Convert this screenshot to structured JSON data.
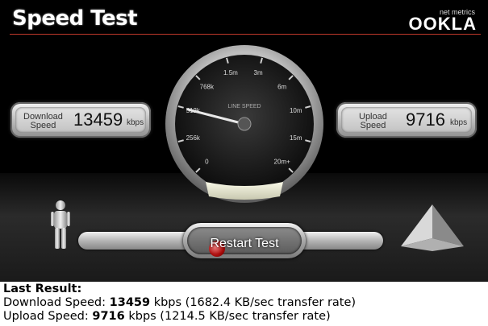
{
  "header": {
    "title": "Speed Test",
    "brand_sub": "net metrics",
    "brand_logo": "OOKLA"
  },
  "gauge": {
    "label": "LINE SPEED",
    "ticks": [
      "0",
      "256k",
      "512k",
      "768k",
      "1.5m",
      "3m",
      "6m",
      "10m",
      "15m",
      "20m+"
    ],
    "needle_fraction": 0.22
  },
  "download": {
    "label_line1": "Download",
    "label_line2": "Speed",
    "value": "13459",
    "unit": "kbps"
  },
  "upload": {
    "label_line1": "Upload",
    "label_line2": "Speed",
    "value": "9716",
    "unit": "kbps"
  },
  "controls": {
    "restart_label": "Restart Test"
  },
  "results": {
    "heading": "Last Result:",
    "download_prefix": "Download Speed: ",
    "download_value": "13459",
    "download_suffix": " kbps (1682.4 KB/sec transfer rate)",
    "upload_prefix": "Upload Speed: ",
    "upload_value": "9716",
    "upload_suffix": " kbps (1214.5 KB/sec transfer rate)"
  },
  "colors": {
    "background": "#000000",
    "accent_line": "#c0392b",
    "button_dot": "#cc0000"
  }
}
